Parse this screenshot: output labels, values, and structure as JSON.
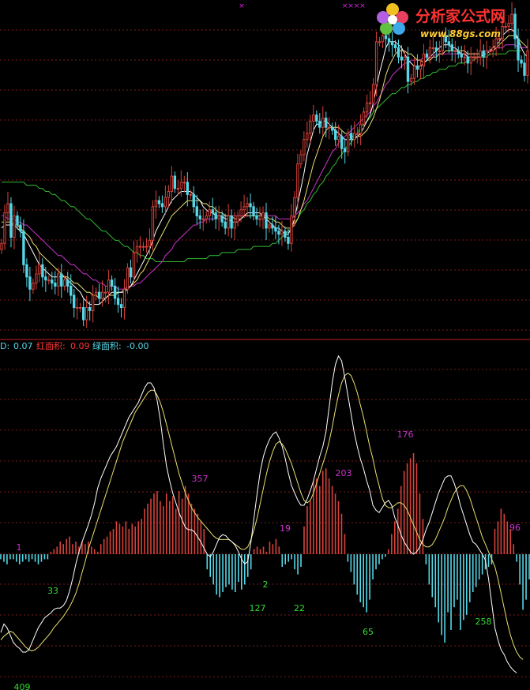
{
  "watermark": {
    "name": "分析家公式网",
    "url": "www.88gs.com"
  },
  "colors": {
    "background": "#000000",
    "grid": "#7a1a1a",
    "divider": "#c02020",
    "up": "#d8423a",
    "down": "#55d8e8",
    "ma_short": "#ffffff",
    "ma_mid": "#e8e070",
    "ma_long": "#cc33cc",
    "ma_vlong": "#33bb33",
    "osc_fast": "#ffffff",
    "osc_slow": "#e8e070",
    "label_pos": "#cc33cc",
    "label_neg": "#33dd33",
    "legend_d": "#55d8e8",
    "legend_red": "#ff3333",
    "legend_green": "#55d8e8",
    "marker": "#dd22dd"
  },
  "legend": {
    "d_label": "D: ",
    "d_value": "0.07",
    "red_label": "红面积: ",
    "red_value": "0.09",
    "green_label": "绿面积: ",
    "green_value": "-0.00"
  },
  "top_markers": [
    "×",
    "×××",
    "×"
  ],
  "chart_data": {
    "type": "candlestick",
    "x": [
      0,
      1,
      2,
      3,
      4,
      5,
      6,
      7,
      8,
      9,
      10,
      11,
      12,
      13,
      14,
      15,
      16,
      17,
      18,
      19,
      20,
      21,
      22,
      23,
      24,
      25,
      26,
      27,
      28,
      29,
      30,
      31,
      32,
      33,
      34,
      35,
      36,
      37,
      38,
      39,
      40,
      41,
      42,
      43,
      44,
      45,
      46,
      47,
      48,
      49,
      50,
      51,
      52,
      53,
      54,
      55,
      56,
      57,
      58,
      59,
      60,
      61,
      62,
      63,
      64,
      65,
      66,
      67,
      68,
      69,
      70,
      71,
      72,
      73,
      74,
      75,
      76,
      77,
      78,
      79,
      80,
      81,
      82,
      83,
      84,
      85,
      86,
      87,
      88,
      89,
      90,
      91,
      92,
      93,
      94,
      95,
      96,
      97,
      98,
      99,
      100,
      101,
      102,
      103,
      104,
      105,
      106,
      107,
      108,
      109,
      110,
      111,
      112,
      113,
      114,
      115,
      116,
      117,
      118,
      119,
      120,
      121,
      122,
      123,
      124,
      125,
      126,
      127,
      128,
      129,
      130,
      131,
      132,
      133,
      134,
      135,
      136,
      137,
      138,
      139,
      140,
      141,
      142,
      143,
      144,
      145,
      146,
      147,
      148,
      149,
      150,
      151,
      152,
      153,
      154,
      155,
      156,
      157,
      158,
      159,
      160,
      161,
      162,
      163,
      164,
      165,
      166,
      167
    ],
    "close": [
      0.25,
      0.35,
      0.38,
      0.27,
      0.34,
      0.31,
      0.29,
      0.18,
      0.14,
      0.1,
      0.12,
      0.15,
      0.18,
      0.14,
      0.13,
      0.13,
      0.12,
      0.11,
      0.15,
      0.11,
      0.13,
      0.11,
      0.08,
      0.04,
      0.04,
      0.04,
      0.0,
      0.04,
      0.03,
      0.08,
      0.09,
      0.07,
      0.09,
      0.09,
      0.13,
      0.11,
      0.07,
      0.05,
      0.04,
      0.1,
      0.17,
      0.14,
      0.22,
      0.24,
      0.24,
      0.24,
      0.24,
      0.26,
      0.37,
      0.39,
      0.38,
      0.37,
      0.4,
      0.42,
      0.47,
      0.43,
      0.43,
      0.45,
      0.45,
      0.41,
      0.41,
      0.37,
      0.34,
      0.33,
      0.33,
      0.34,
      0.36,
      0.35,
      0.33,
      0.34,
      0.32,
      0.3,
      0.34,
      0.3,
      0.32,
      0.34,
      0.36,
      0.37,
      0.38,
      0.37,
      0.34,
      0.33,
      0.33,
      0.35,
      0.3,
      0.31,
      0.3,
      0.29,
      0.28,
      0.29,
      0.27,
      0.25,
      0.34,
      0.4,
      0.51,
      0.54,
      0.59,
      0.61,
      0.65,
      0.67,
      0.65,
      0.63,
      0.66,
      0.63,
      0.63,
      0.62,
      0.59,
      0.6,
      0.56,
      0.55,
      0.61,
      0.59,
      0.61,
      0.61,
      0.64,
      0.68,
      0.71,
      0.71,
      0.77,
      0.91,
      0.91,
      0.93,
      0.92,
      0.91,
      0.9,
      0.89,
      0.86,
      0.85,
      0.86,
      0.78,
      0.79,
      0.83,
      0.82,
      0.83,
      0.87,
      0.86,
      0.89,
      0.89,
      0.88,
      0.88,
      0.93,
      0.91,
      0.9,
      0.88,
      0.88,
      0.87,
      0.86,
      0.86,
      0.84,
      0.86,
      0.86,
      0.86,
      0.88,
      0.86,
      0.88,
      0.88,
      0.89,
      0.92,
      0.92,
      0.96,
      0.96,
      0.97,
      1.0,
      0.92,
      0.85,
      0.84,
      0.8,
      0.88
    ],
    "ma_short": [
      0.3,
      0.31,
      0.31,
      0.31,
      0.31,
      0.3,
      0.29,
      0.28,
      0.26,
      0.24,
      0.22,
      0.2,
      0.18,
      0.17,
      0.16,
      0.15,
      0.14,
      0.14,
      0.14,
      0.14,
      0.14,
      0.13,
      0.12,
      0.11,
      0.1,
      0.09,
      0.07,
      0.06,
      0.05,
      0.05,
      0.05,
      0.05,
      0.06,
      0.07,
      0.08,
      0.09,
      0.09,
      0.09,
      0.09,
      0.09,
      0.1,
      0.11,
      0.13,
      0.15,
      0.17,
      0.19,
      0.21,
      0.23,
      0.26,
      0.29,
      0.31,
      0.33,
      0.35,
      0.37,
      0.39,
      0.4,
      0.41,
      0.42,
      0.42,
      0.42,
      0.42,
      0.41,
      0.4,
      0.39,
      0.37,
      0.36,
      0.35,
      0.35,
      0.34,
      0.34,
      0.34,
      0.33,
      0.33,
      0.32,
      0.32,
      0.32,
      0.33,
      0.34,
      0.35,
      0.35,
      0.35,
      0.35,
      0.35,
      0.34,
      0.33,
      0.32,
      0.31,
      0.3,
      0.3,
      0.29,
      0.28,
      0.28,
      0.3,
      0.33,
      0.38,
      0.43,
      0.48,
      0.54,
      0.58,
      0.62,
      0.64,
      0.64,
      0.65,
      0.65,
      0.64,
      0.63,
      0.62,
      0.61,
      0.6,
      0.59,
      0.59,
      0.59,
      0.59,
      0.6,
      0.61,
      0.63,
      0.65,
      0.67,
      0.71,
      0.76,
      0.81,
      0.85,
      0.89,
      0.91,
      0.91,
      0.91,
      0.9,
      0.89,
      0.87,
      0.85,
      0.84,
      0.83,
      0.83,
      0.83,
      0.84,
      0.85,
      0.86,
      0.87,
      0.88,
      0.89,
      0.9,
      0.9,
      0.9,
      0.89,
      0.89,
      0.88,
      0.87,
      0.87,
      0.86,
      0.86,
      0.86,
      0.86,
      0.86,
      0.87,
      0.87,
      0.88,
      0.89,
      0.9,
      0.91,
      0.93,
      0.94,
      0.95,
      0.95,
      0.94,
      0.92,
      0.89,
      0.87,
      0.86
    ],
    "ma_mid": [
      0.32,
      0.32,
      0.32,
      0.32,
      0.31,
      0.31,
      0.3,
      0.29,
      0.28,
      0.27,
      0.25,
      0.24,
      0.22,
      0.21,
      0.2,
      0.19,
      0.18,
      0.17,
      0.16,
      0.15,
      0.14,
      0.14,
      0.13,
      0.12,
      0.12,
      0.11,
      0.1,
      0.09,
      0.09,
      0.08,
      0.08,
      0.07,
      0.07,
      0.07,
      0.08,
      0.08,
      0.08,
      0.09,
      0.09,
      0.1,
      0.1,
      0.11,
      0.12,
      0.13,
      0.15,
      0.16,
      0.18,
      0.2,
      0.22,
      0.24,
      0.26,
      0.28,
      0.3,
      0.32,
      0.34,
      0.35,
      0.36,
      0.37,
      0.38,
      0.39,
      0.39,
      0.39,
      0.39,
      0.39,
      0.38,
      0.38,
      0.37,
      0.37,
      0.36,
      0.35,
      0.35,
      0.34,
      0.34,
      0.34,
      0.33,
      0.33,
      0.33,
      0.34,
      0.34,
      0.34,
      0.34,
      0.34,
      0.34,
      0.34,
      0.34,
      0.33,
      0.33,
      0.32,
      0.32,
      0.31,
      0.3,
      0.3,
      0.3,
      0.31,
      0.33,
      0.36,
      0.39,
      0.43,
      0.47,
      0.51,
      0.54,
      0.57,
      0.6,
      0.62,
      0.63,
      0.63,
      0.63,
      0.63,
      0.62,
      0.61,
      0.61,
      0.6,
      0.6,
      0.6,
      0.6,
      0.61,
      0.62,
      0.64,
      0.66,
      0.69,
      0.72,
      0.76,
      0.8,
      0.83,
      0.85,
      0.87,
      0.88,
      0.88,
      0.88,
      0.87,
      0.87,
      0.86,
      0.85,
      0.85,
      0.84,
      0.85,
      0.85,
      0.86,
      0.86,
      0.87,
      0.87,
      0.88,
      0.88,
      0.88,
      0.88,
      0.88,
      0.88,
      0.88,
      0.87,
      0.87,
      0.87,
      0.87,
      0.87,
      0.87,
      0.87,
      0.88,
      0.88,
      0.89,
      0.9,
      0.91,
      0.92,
      0.93,
      0.93,
      0.93,
      0.92,
      0.91,
      0.9,
      0.89
    ],
    "ma_long": [
      0.34,
      0.34,
      0.33,
      0.33,
      0.33,
      0.32,
      0.32,
      0.31,
      0.31,
      0.3,
      0.29,
      0.28,
      0.27,
      0.26,
      0.25,
      0.24,
      0.23,
      0.22,
      0.21,
      0.21,
      0.2,
      0.19,
      0.18,
      0.18,
      0.17,
      0.16,
      0.15,
      0.15,
      0.14,
      0.13,
      0.13,
      0.12,
      0.12,
      0.11,
      0.11,
      0.11,
      0.11,
      0.1,
      0.1,
      0.1,
      0.11,
      0.11,
      0.11,
      0.12,
      0.12,
      0.13,
      0.14,
      0.15,
      0.16,
      0.17,
      0.18,
      0.19,
      0.21,
      0.22,
      0.23,
      0.25,
      0.26,
      0.27,
      0.28,
      0.29,
      0.3,
      0.31,
      0.31,
      0.32,
      0.32,
      0.33,
      0.33,
      0.33,
      0.33,
      0.34,
      0.34,
      0.34,
      0.34,
      0.34,
      0.34,
      0.34,
      0.34,
      0.34,
      0.34,
      0.34,
      0.34,
      0.34,
      0.34,
      0.34,
      0.34,
      0.34,
      0.34,
      0.34,
      0.33,
      0.33,
      0.33,
      0.33,
      0.33,
      0.34,
      0.35,
      0.36,
      0.38,
      0.39,
      0.41,
      0.43,
      0.45,
      0.47,
      0.49,
      0.51,
      0.53,
      0.55,
      0.56,
      0.58,
      0.59,
      0.6,
      0.61,
      0.62,
      0.63,
      0.64,
      0.65,
      0.66,
      0.67,
      0.68,
      0.7,
      0.71,
      0.73,
      0.75,
      0.77,
      0.78,
      0.8,
      0.81,
      0.82,
      0.83,
      0.84,
      0.84,
      0.85,
      0.85,
      0.85,
      0.85,
      0.86,
      0.86,
      0.86,
      0.86,
      0.87,
      0.87,
      0.87,
      0.87,
      0.87,
      0.87,
      0.87,
      0.87,
      0.87,
      0.87,
      0.87,
      0.87,
      0.87,
      0.87,
      0.87,
      0.88,
      0.88,
      0.88,
      0.88,
      0.89,
      0.89,
      0.89,
      0.9,
      0.9,
      0.9,
      0.9,
      0.89,
      0.89,
      0.89,
      0.89
    ],
    "ma_vlong": [
      0.45,
      0.45,
      0.45,
      0.45,
      0.45,
      0.45,
      0.45,
      0.45,
      0.44,
      0.44,
      0.44,
      0.44,
      0.43,
      0.43,
      0.42,
      0.42,
      0.41,
      0.41,
      0.4,
      0.39,
      0.39,
      0.38,
      0.37,
      0.37,
      0.36,
      0.35,
      0.34,
      0.33,
      0.33,
      0.32,
      0.31,
      0.3,
      0.29,
      0.29,
      0.28,
      0.27,
      0.26,
      0.26,
      0.25,
      0.24,
      0.24,
      0.23,
      0.22,
      0.22,
      0.21,
      0.21,
      0.2,
      0.2,
      0.2,
      0.19,
      0.19,
      0.19,
      0.19,
      0.19,
      0.19,
      0.19,
      0.19,
      0.19,
      0.19,
      0.2,
      0.2,
      0.2,
      0.2,
      0.2,
      0.2,
      0.2,
      0.21,
      0.21,
      0.21,
      0.21,
      0.22,
      0.22,
      0.22,
      0.22,
      0.22,
      0.23,
      0.23,
      0.23,
      0.23,
      0.23,
      0.24,
      0.24,
      0.24,
      0.24,
      0.24,
      0.24,
      0.25,
      0.25,
      0.26,
      0.27,
      0.28,
      0.29,
      0.3,
      0.32,
      0.33,
      0.35,
      0.36,
      0.38,
      0.39,
      0.41,
      0.42,
      0.44,
      0.45,
      0.47,
      0.48,
      0.5,
      0.51,
      0.53,
      0.54,
      0.56,
      0.57,
      0.58,
      0.6,
      0.61,
      0.63,
      0.64,
      0.65,
      0.66,
      0.68,
      0.69,
      0.7,
      0.71,
      0.72,
      0.73,
      0.74,
      0.74,
      0.75,
      0.76,
      0.76,
      0.77,
      0.77,
      0.78,
      0.78,
      0.79,
      0.79,
      0.8,
      0.8,
      0.81,
      0.81,
      0.82,
      0.82,
      0.82,
      0.83,
      0.83,
      0.83,
      0.84,
      0.84,
      0.84,
      0.85,
      0.85,
      0.85,
      0.86,
      0.86,
      0.86,
      0.86,
      0.87,
      0.87,
      0.87,
      0.87,
      0.87,
      0.87,
      0.88,
      0.88,
      0.88,
      0.88,
      0.88
    ],
    "histogram": [
      -2,
      -3,
      -4,
      -2,
      -2,
      -3,
      -4,
      -3,
      -2,
      -3,
      -2,
      -3,
      -4,
      -3,
      -2,
      -2,
      1,
      2,
      3,
      5,
      4,
      6,
      7,
      4,
      5,
      3,
      5,
      4,
      5,
      3,
      2,
      1,
      4,
      6,
      7,
      9,
      10,
      13,
      12,
      11,
      13,
      10,
      12,
      11,
      13,
      14,
      18,
      20,
      22,
      24,
      25,
      21,
      19,
      24,
      21,
      23,
      18,
      25,
      22,
      27,
      24,
      20,
      18,
      16,
      13,
      10,
      -6,
      -9,
      -12,
      -16,
      -17,
      -15,
      -13,
      -12,
      -14,
      -15,
      -11,
      -14,
      -12,
      -9,
      -6,
      2,
      3,
      2,
      3,
      1,
      5,
      4,
      6,
      3,
      -5,
      -4,
      -3,
      -2,
      -6,
      -8,
      -5,
      11,
      19,
      21,
      29,
      30,
      27,
      33,
      34,
      30,
      27,
      24,
      21,
      16,
      8,
      -3,
      -7,
      -12,
      -16,
      -19,
      -21,
      -23,
      -18,
      -10,
      -6,
      -4,
      -2,
      -1,
      2,
      8,
      13,
      18,
      27,
      33,
      36,
      38,
      40,
      36,
      24,
      14,
      -4,
      -12,
      -17,
      -21,
      -27,
      -32,
      -35,
      -23,
      -30,
      -21,
      -18,
      -30,
      -26,
      -24,
      -19,
      -15,
      -13,
      -10,
      -8,
      -6,
      -5,
      -4,
      10,
      13,
      18,
      16,
      13,
      10,
      4,
      -3,
      -12,
      -22,
      -18,
      -10
    ],
    "osc_fast": [
      -64,
      -57,
      -60,
      -66,
      -72,
      -75,
      -77,
      -80,
      -80,
      -78,
      -72,
      -66,
      -60,
      -56,
      -52,
      -50,
      -48,
      -45,
      -44,
      -44,
      -42,
      -38,
      -30,
      -20,
      -8,
      2,
      10,
      17,
      24,
      32,
      42,
      54,
      62,
      68,
      74,
      80,
      84,
      88,
      94,
      100,
      106,
      112,
      116,
      120,
      124,
      130,
      136,
      140,
      140,
      136,
      126,
      110,
      90,
      72,
      60,
      50,
      42,
      34,
      28,
      22,
      20,
      20,
      18,
      14,
      10,
      5,
      0,
      -2,
      2,
      8,
      14,
      16,
      15,
      12,
      10,
      7,
      2,
      -4,
      -8,
      -6,
      10,
      30,
      50,
      68,
      80,
      88,
      94,
      98,
      100,
      95,
      88,
      78,
      66,
      56,
      50,
      44,
      40,
      40,
      45,
      52,
      60,
      70,
      80,
      88,
      100,
      120,
      140,
      155,
      162,
      158,
      145,
      130,
      115,
      100,
      88,
      78,
      70,
      60,
      52,
      40,
      36,
      34,
      38,
      42,
      44,
      40,
      30,
      24,
      16,
      10,
      6,
      2,
      0,
      2,
      6,
      12,
      20,
      26,
      34,
      42,
      50,
      56,
      62,
      64,
      64,
      58,
      50,
      40,
      32,
      24,
      16,
      10,
      8,
      4,
      0,
      -5,
      -20,
      -40,
      -60,
      -70,
      -78,
      -82,
      -88,
      -92,
      -95,
      -97
    ],
    "osc_slow": [
      -70,
      -67,
      -65,
      -63,
      -64,
      -67,
      -70,
      -73,
      -76,
      -78,
      -79,
      -78,
      -76,
      -73,
      -70,
      -67,
      -64,
      -60,
      -57,
      -54,
      -51,
      -47,
      -43,
      -38,
      -32,
      -24,
      -15,
      -6,
      4,
      12,
      20,
      28,
      36,
      44,
      52,
      60,
      68,
      76,
      84,
      92,
      98,
      104,
      110,
      116,
      120,
      124,
      128,
      132,
      134,
      134,
      130,
      124,
      116,
      106,
      96,
      86,
      76,
      66,
      58,
      50,
      44,
      38,
      34,
      30,
      27,
      24,
      21,
      18,
      15,
      13,
      12,
      12,
      12,
      12,
      10,
      8,
      6,
      4,
      4,
      6,
      12,
      20,
      30,
      42,
      54,
      66,
      76,
      84,
      90,
      92,
      90,
      86,
      80,
      74,
      66,
      58,
      50,
      44,
      42,
      44,
      50,
      58,
      66,
      74,
      82,
      92,
      104,
      118,
      130,
      140,
      146,
      148,
      146,
      140,
      132,
      122,
      112,
      100,
      88,
      78,
      66,
      56,
      46,
      40,
      38,
      38,
      40,
      42,
      42,
      40,
      36,
      30,
      24,
      18,
      12,
      8,
      6,
      6,
      8,
      12,
      18,
      24,
      30,
      38,
      44,
      50,
      54,
      56,
      56,
      52,
      46,
      38,
      30,
      22,
      14,
      8,
      2,
      -4,
      -10,
      -20,
      -32,
      -44,
      -56,
      -66,
      -74,
      -80,
      -84,
      -86
    ],
    "labels": [
      {
        "i": 14,
        "text": "1",
        "sign": "pos"
      },
      {
        "i": 40,
        "text": "33",
        "sign": "neg"
      },
      {
        "i": 148,
        "text": "357",
        "sign": "pos"
      },
      {
        "i": 198,
        "text": "127",
        "sign": "neg"
      },
      {
        "i": 203,
        "text": "2",
        "sign": "neg"
      },
      {
        "i": 210,
        "text": "19",
        "sign": "pos"
      },
      {
        "i": 228,
        "text": "22",
        "sign": "neg"
      },
      {
        "i": 262,
        "text": "203",
        "sign": "pos"
      },
      {
        "i": 280,
        "text": "65",
        "sign": "neg"
      },
      {
        "i": 310,
        "text": "176",
        "sign": "pos"
      },
      {
        "i": 366,
        "text": "258",
        "sign": "neg"
      },
      {
        "i": 398,
        "text": "96",
        "sign": "pos"
      },
      {
        "i": 18,
        "text": "409",
        "sign": "neg"
      }
    ]
  }
}
